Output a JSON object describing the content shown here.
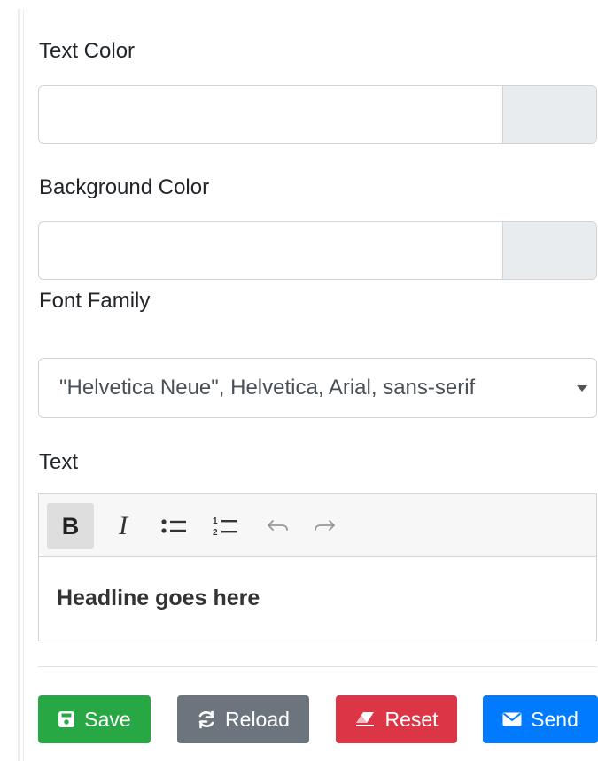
{
  "fields": {
    "text_color": {
      "label": "Text Color",
      "value": ""
    },
    "background_color": {
      "label": "Background Color",
      "value": ""
    },
    "font_family": {
      "label": "Font Family",
      "selected": "\"Helvetica Neue\", Helvetica, Arial, sans-serif"
    },
    "text": {
      "label": "Text"
    }
  },
  "editor": {
    "toolbar": {
      "bold_label": "B",
      "italic_label": "I",
      "bold_active": true
    },
    "content": "Headline goes here"
  },
  "actions": {
    "save": "Save",
    "reload": "Reload",
    "reset": "Reset",
    "send": "Send"
  },
  "colors": {
    "save": "#28a745",
    "reload": "#6c757d",
    "reset": "#dc3545",
    "send": "#007bff"
  }
}
